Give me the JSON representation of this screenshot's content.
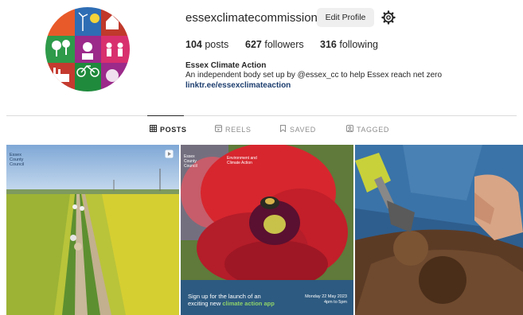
{
  "profile": {
    "username": "essexclimatecommission",
    "edit_label": "Edit Profile",
    "posts_count": "104",
    "posts_label": "posts",
    "followers_count": "627",
    "followers_label": "followers",
    "following_count": "316",
    "following_label": "following",
    "full_name": "Essex Climate Action",
    "bio": "An independent body set up by @essex_cc to help Essex reach net zero",
    "link": "linktr.ee/essexclimateaction"
  },
  "tabs": [
    {
      "label": "POSTS",
      "icon": "grid-icon",
      "active": true
    },
    {
      "label": "REELS",
      "icon": "reels-icon",
      "active": false
    },
    {
      "label": "SAVED",
      "icon": "bookmark-icon",
      "active": false
    },
    {
      "label": "TAGGED",
      "icon": "tagged-icon",
      "active": false
    }
  ],
  "posts": [
    {
      "logo_line1": "Essex",
      "logo_line2": "County",
      "logo_line3": "Council",
      "is_reel": true
    },
    {
      "logo_line1": "Essex",
      "logo_line2": "County",
      "logo_line3": "Council",
      "header_line1": "Environment and",
      "header_line2": "Climate Action",
      "caption_line1": "Sign up for the launch of an",
      "caption_line2a": "exciting new ",
      "caption_line2b": "climate action app",
      "date_line1": "Monday 22 May 2023",
      "date_line2": "4pm to 5pm"
    },
    {}
  ],
  "colors": {
    "avatar_segments": [
      "#c0392b",
      "#2e6db4",
      "#e85a2a",
      "#2e9a4a",
      "#9b2a8a",
      "#d8306e",
      "#c43a2f",
      "#1f8a3c"
    ],
    "link": "#1c3d6e",
    "caption_band": "#2d5a80",
    "caption_accent": "#8fd26a"
  }
}
